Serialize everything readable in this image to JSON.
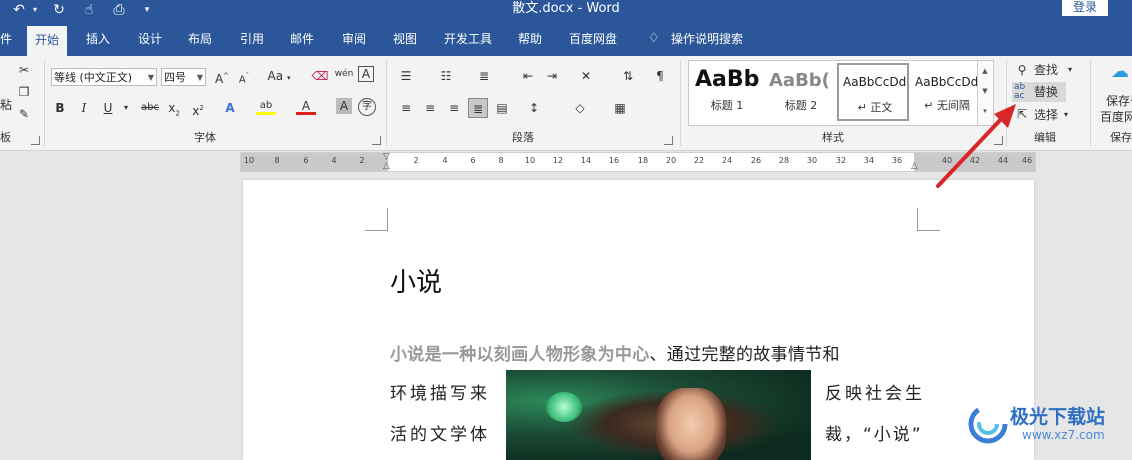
{
  "title_bar": {
    "document_title": "散文.docx - Word",
    "login_label": "登录",
    "quick_access": [
      "undo-icon",
      "undo-dropdown-icon",
      "redo-icon",
      "touch-mode-icon",
      "print-preview-icon",
      "customize-qat-icon"
    ]
  },
  "tabs": {
    "file": "件",
    "home": "开始",
    "insert": "插入",
    "design": "设计",
    "layout": "布局",
    "references": "引用",
    "mailings": "邮件",
    "review": "审阅",
    "view": "视图",
    "developer": "开发工具",
    "help": "帮助",
    "baidu": "百度网盘",
    "tell_me": "操作说明搜索"
  },
  "clipboard": {
    "paste_label": "粘",
    "group_label": "板"
  },
  "font_group": {
    "font_name": "等线 (中文正文)",
    "font_size": "四号",
    "grow": "A",
    "shrink": "A",
    "change_case": "Aa",
    "phonetic": "wén",
    "border_char": "A",
    "bold": "B",
    "italic": "I",
    "underline": "U",
    "strike": "abc",
    "subscript": "x",
    "superscript": "x",
    "highlight": "ab",
    "font_color": "A",
    "char_shading": "A",
    "enclose": "字",
    "text_effects": "A",
    "group_label": "字体"
  },
  "paragraph_group": {
    "group_label": "段落"
  },
  "styles_group": {
    "items": [
      {
        "sample": "AaBb",
        "name": "标题 1"
      },
      {
        "sample": "AaBb(",
        "name": "标题 2"
      },
      {
        "sample": "AaBbCcDd",
        "name": "↵ 正文"
      },
      {
        "sample": "AaBbCcDd",
        "name": "↵ 无间隔"
      }
    ],
    "group_label": "样式"
  },
  "editing_group": {
    "find": "查找",
    "replace": "替换",
    "select": "选择",
    "group_label": "编辑"
  },
  "save_group": {
    "save_line1": "保存于",
    "save_line2": "百度网",
    "group_label": "保存"
  },
  "ruler": {
    "left_numbers": [
      "10",
      "8",
      "6",
      "4",
      "2"
    ],
    "right_numbers": [
      "2",
      "4",
      "6",
      "8",
      "10",
      "12",
      "14",
      "16",
      "18",
      "20",
      "22",
      "24",
      "26",
      "28",
      "30",
      "32",
      "34",
      "36"
    ],
    "margin_numbers": [
      "40",
      "42",
      "44",
      "46"
    ]
  },
  "document": {
    "heading": "小说",
    "para1_emph": "小说是一种以刻画人物形象为中心",
    "para1_rest": "、通过完整的故事情节和",
    "line2_left": "环境描写来",
    "line2_right": "反映社会生",
    "line3_left": "活的文学体",
    "line3_right": "裁，“小说”"
  },
  "watermark": {
    "name": "极光下载站",
    "url": "www.xz7.com"
  },
  "colors": {
    "title_bar": "#2b579a",
    "ribbon": "#f3f3f3",
    "arrow": "#d9262b"
  }
}
